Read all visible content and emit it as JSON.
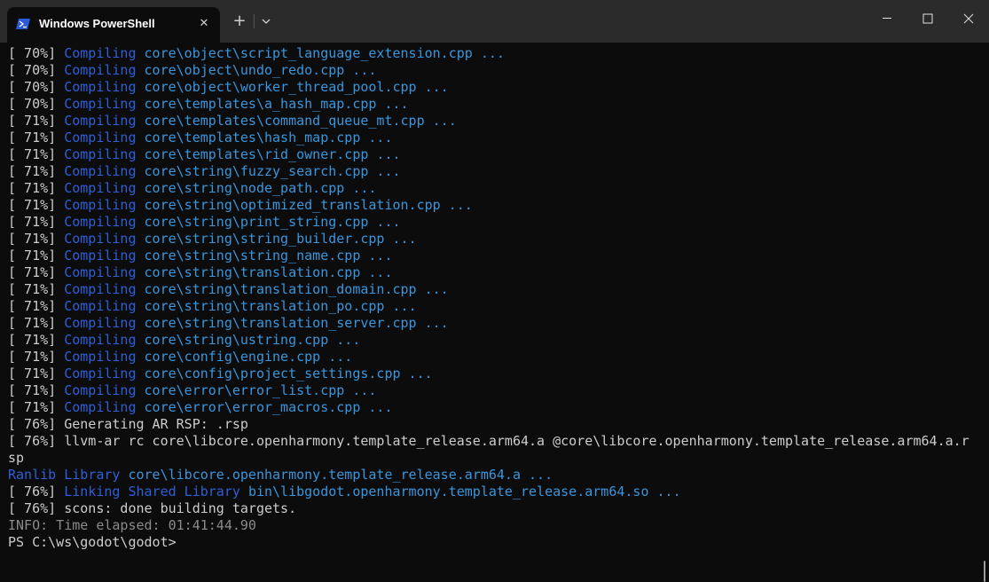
{
  "window": {
    "tab_title": "Windows PowerShell",
    "tab_icon": "powershell-icon",
    "close_tab_glyph": "✕",
    "new_tab_glyph": "+"
  },
  "colors": {
    "background": "#0c0c0c",
    "titlebar": "#2b2b2b",
    "text": "#cccccc",
    "compiling": "#2f5fd8",
    "path": "#3a96dd",
    "info": "#8a8a8a"
  },
  "terminal": {
    "lines": [
      [
        {
          "t": "[ 70%] ",
          "c": "w"
        },
        {
          "t": "Compiling ",
          "c": "b"
        },
        {
          "t": "core\\object\\script_language_extension.cpp ...",
          "c": "bl"
        }
      ],
      [
        {
          "t": "[ 70%] ",
          "c": "w"
        },
        {
          "t": "Compiling ",
          "c": "b"
        },
        {
          "t": "core\\object\\undo_redo.cpp ...",
          "c": "bl"
        }
      ],
      [
        {
          "t": "[ 70%] ",
          "c": "w"
        },
        {
          "t": "Compiling ",
          "c": "b"
        },
        {
          "t": "core\\object\\worker_thread_pool.cpp ...",
          "c": "bl"
        }
      ],
      [
        {
          "t": "[ 70%] ",
          "c": "w"
        },
        {
          "t": "Compiling ",
          "c": "b"
        },
        {
          "t": "core\\templates\\a_hash_map.cpp ...",
          "c": "bl"
        }
      ],
      [
        {
          "t": "[ 71%] ",
          "c": "w"
        },
        {
          "t": "Compiling ",
          "c": "b"
        },
        {
          "t": "core\\templates\\command_queue_mt.cpp ...",
          "c": "bl"
        }
      ],
      [
        {
          "t": "[ 71%] ",
          "c": "w"
        },
        {
          "t": "Compiling ",
          "c": "b"
        },
        {
          "t": "core\\templates\\hash_map.cpp ...",
          "c": "bl"
        }
      ],
      [
        {
          "t": "[ 71%] ",
          "c": "w"
        },
        {
          "t": "Compiling ",
          "c": "b"
        },
        {
          "t": "core\\templates\\rid_owner.cpp ...",
          "c": "bl"
        }
      ],
      [
        {
          "t": "[ 71%] ",
          "c": "w"
        },
        {
          "t": "Compiling ",
          "c": "b"
        },
        {
          "t": "core\\string\\fuzzy_search.cpp ...",
          "c": "bl"
        }
      ],
      [
        {
          "t": "[ 71%] ",
          "c": "w"
        },
        {
          "t": "Compiling ",
          "c": "b"
        },
        {
          "t": "core\\string\\node_path.cpp ...",
          "c": "bl"
        }
      ],
      [
        {
          "t": "[ 71%] ",
          "c": "w"
        },
        {
          "t": "Compiling ",
          "c": "b"
        },
        {
          "t": "core\\string\\optimized_translation.cpp ...",
          "c": "bl"
        }
      ],
      [
        {
          "t": "[ 71%] ",
          "c": "w"
        },
        {
          "t": "Compiling ",
          "c": "b"
        },
        {
          "t": "core\\string\\print_string.cpp ...",
          "c": "bl"
        }
      ],
      [
        {
          "t": "[ 71%] ",
          "c": "w"
        },
        {
          "t": "Compiling ",
          "c": "b"
        },
        {
          "t": "core\\string\\string_builder.cpp ...",
          "c": "bl"
        }
      ],
      [
        {
          "t": "[ 71%] ",
          "c": "w"
        },
        {
          "t": "Compiling ",
          "c": "b"
        },
        {
          "t": "core\\string\\string_name.cpp ...",
          "c": "bl"
        }
      ],
      [
        {
          "t": "[ 71%] ",
          "c": "w"
        },
        {
          "t": "Compiling ",
          "c": "b"
        },
        {
          "t": "core\\string\\translation.cpp ...",
          "c": "bl"
        }
      ],
      [
        {
          "t": "[ 71%] ",
          "c": "w"
        },
        {
          "t": "Compiling ",
          "c": "b"
        },
        {
          "t": "core\\string\\translation_domain.cpp ...",
          "c": "bl"
        }
      ],
      [
        {
          "t": "[ 71%] ",
          "c": "w"
        },
        {
          "t": "Compiling ",
          "c": "b"
        },
        {
          "t": "core\\string\\translation_po.cpp ...",
          "c": "bl"
        }
      ],
      [
        {
          "t": "[ 71%] ",
          "c": "w"
        },
        {
          "t": "Compiling ",
          "c": "b"
        },
        {
          "t": "core\\string\\translation_server.cpp ...",
          "c": "bl"
        }
      ],
      [
        {
          "t": "[ 71%] ",
          "c": "w"
        },
        {
          "t": "Compiling ",
          "c": "b"
        },
        {
          "t": "core\\string\\ustring.cpp ...",
          "c": "bl"
        }
      ],
      [
        {
          "t": "[ 71%] ",
          "c": "w"
        },
        {
          "t": "Compiling ",
          "c": "b"
        },
        {
          "t": "core\\config\\engine.cpp ...",
          "c": "bl"
        }
      ],
      [
        {
          "t": "[ 71%] ",
          "c": "w"
        },
        {
          "t": "Compiling ",
          "c": "b"
        },
        {
          "t": "core\\config\\project_settings.cpp ...",
          "c": "bl"
        }
      ],
      [
        {
          "t": "[ 71%] ",
          "c": "w"
        },
        {
          "t": "Compiling ",
          "c": "b"
        },
        {
          "t": "core\\error\\error_list.cpp ...",
          "c": "bl"
        }
      ],
      [
        {
          "t": "[ 71%] ",
          "c": "w"
        },
        {
          "t": "Compiling ",
          "c": "b"
        },
        {
          "t": "core\\error\\error_macros.cpp ...",
          "c": "bl"
        }
      ],
      [
        {
          "t": "[ 76%] Generating AR RSP: .rsp",
          "c": "w"
        }
      ],
      [
        {
          "t": "[ 76%] llvm-ar rc core\\libcore.openharmony.template_release.arm64.a @core\\libcore.openharmony.template_release.arm64.a.r",
          "c": "w"
        }
      ],
      [
        {
          "t": "sp",
          "c": "w"
        }
      ],
      [
        {
          "t": "Ranlib Library ",
          "c": "b"
        },
        {
          "t": "core\\libcore.openharmony.template_release.arm64.a ...",
          "c": "bl"
        }
      ],
      [
        {
          "t": "[ 76%] ",
          "c": "w"
        },
        {
          "t": "Linking Shared Library ",
          "c": "b"
        },
        {
          "t": "bin\\libgodot.openharmony.template_release.arm64.so ...",
          "c": "bl"
        }
      ],
      [
        {
          "t": "[ 76%] scons: done building targets.",
          "c": "w"
        }
      ],
      [
        {
          "t": "INFO: Time elapsed: 01:41:44.90",
          "c": "g"
        }
      ],
      [
        {
          "t": "PS C:\\ws\\godot\\godot>",
          "c": "w"
        }
      ]
    ]
  }
}
